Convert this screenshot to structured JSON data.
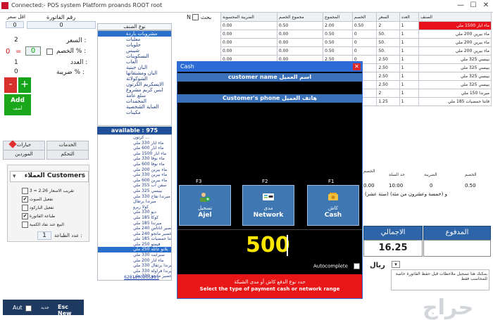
{
  "window": {
    "title": "Connected:- POS system Platform proands ROOT root",
    "controls": [
      "—",
      "☐",
      "✕"
    ]
  },
  "left_panel": {
    "invoice_label": "رقم الفاتورة",
    "invoice_value": "0",
    "min_price_label": "اقل سعر",
    "min_price_value": "0",
    "price_label": "السعر :",
    "price_value": "2",
    "discount_label": "الخصم % :",
    "discount_left": "0",
    "discount_value": "0",
    "count_label": "العدد :",
    "count_value": "1",
    "tax_label": "ضريبة % :",
    "tax_value": "0",
    "minus_label": "-",
    "plus_label": "+",
    "add_label": "Add",
    "add_sub_label": "أضف",
    "tabs": [
      {
        "label": "خيارات"
      },
      {
        "label": "الخدمات"
      },
      {
        "label": "الموردين"
      },
      {
        "label": "التحكم"
      }
    ],
    "customers_title": "العملاء Customers",
    "options": [
      {
        "label": "تقريب الاسعار 2.26 = 3",
        "checked": false
      },
      {
        "label": "تفعيل الصوت",
        "checked": true
      },
      {
        "label": "تفعيل الباركود",
        "checked": false
      },
      {
        "label": "طباعة الفاتورة",
        "checked": true
      },
      {
        "label": "البيع عند نفاد الكمية",
        "checked": false
      }
    ],
    "print_count_label": "عدد الطباعة :",
    "print_count_value": "1"
  },
  "bottom_bar": {
    "auto_label": "Aut",
    "new_label": "Esc New",
    "new_sub": "جديد"
  },
  "category": {
    "header": "نوع الصنف",
    "items": [
      {
        "label": "مشروبات باردة",
        "selected": true
      },
      {
        "label": "معلبات",
        "selected": false
      },
      {
        "label": "حلويات",
        "selected": false
      },
      {
        "label": "شيبس",
        "selected": false
      },
      {
        "label": "البسكويتات",
        "selected": false
      },
      {
        "label": "العاب",
        "selected": false
      },
      {
        "label": "البان جبنية",
        "selected": false
      },
      {
        "label": "البان ومشتقاتها",
        "selected": false
      },
      {
        "label": "الشوكولاتة",
        "selected": false
      },
      {
        "label": "الايسكريم الكرتون",
        "selected": false
      },
      {
        "label": "ايس كريم مشروع",
        "selected": false
      },
      {
        "label": "سلع عامة",
        "selected": false
      },
      {
        "label": "المجمدات",
        "selected": false
      },
      {
        "label": "العناية الشخصية",
        "selected": false
      },
      {
        "label": "مكينات",
        "selected": false
      }
    ],
    "available_label": "available : 975"
  },
  "products": {
    "items": [
      {
        "label": "كرتون ...",
        "selected": false
      },
      {
        "label": "ماء ابار 330 ملي",
        "selected": false
      },
      {
        "label": "ماء ابار 600 ملي",
        "selected": false
      },
      {
        "label": "ماء ابار 1500 ملي",
        "selected": false
      },
      {
        "label": "ماء نوفا 330 ملي",
        "selected": false
      },
      {
        "label": "ماء نوفا 600 ملي",
        "selected": false
      },
      {
        "label": "ماء بيرين 200 ملي",
        "selected": false
      },
      {
        "label": "ماء بيرين 330 ملي",
        "selected": false
      },
      {
        "label": "ماء بيرين 600 ملي",
        "selected": false
      },
      {
        "label": "سفن اب 355 ملي",
        "selected": false
      },
      {
        "label": "بيبسي 325 ملي",
        "selected": false
      },
      {
        "label": "ميرندا تفاح 330 ملي",
        "selected": false
      },
      {
        "label": "ميرندا برتقال",
        "selected": false
      },
      {
        "label": "كولا زيرو",
        "selected": false
      },
      {
        "label": "ديو 330 ملي",
        "selected": false
      },
      {
        "label": "كوكا 185 ملي",
        "selected": false
      },
      {
        "label": "ميرندا 185 ملي",
        "selected": false
      },
      {
        "label": "راني عصير اناناس 240 ملي",
        "selected": false
      },
      {
        "label": "راني عصير مانجو 240 ملي",
        "selected": false
      },
      {
        "label": "فانتا حمضيات 185 ملي",
        "selected": false
      },
      {
        "label": "فيمتو 250 ملي",
        "selected": false
      },
      {
        "label": "بلانو عائلة 250 ملي",
        "selected": true
      },
      {
        "label": "سبرايت 330 ملي",
        "selected": false
      },
      {
        "label": "ماء ابار 200 ملي",
        "selected": false
      },
      {
        "label": "ميرندا برتقال 330 ملي",
        "selected": false
      },
      {
        "label": "ميرندا فراولة 330 ملي",
        "selected": false
      },
      {
        "label": "عصير مانجو 330 ملي",
        "selected": false
      }
    ],
    "barcode": "6281100205311"
  },
  "search": {
    "label": "بحث",
    "n_label": "N"
  },
  "grid": {
    "headers": [
      "الصنف",
      "العدد",
      "السعر",
      "الخصم",
      "المجموع",
      "مجموع الخصم",
      "الضريبة المحسوبة"
    ],
    "rows": [
      [
        "ماء ابار 1500 ملي",
        "1",
        "2",
        "0.50",
        "2.00",
        "0.50",
        "0.00"
      ],
      [
        "ماء بيرين 200 ملي",
        "1",
        "50.",
        "0",
        "0.50",
        "0.00",
        "0.00"
      ],
      [
        "ماء بيرين 200 ملي",
        "1",
        "50.",
        "0",
        "0.50",
        "0.00",
        "0.00"
      ],
      [
        "ماء بيرين 200 ملي",
        "1",
        "50.",
        "0",
        "0.50",
        "0.00",
        "0.00"
      ],
      [
        "بيبسي 325 ملي",
        "1",
        "2.50",
        "0",
        "2.50",
        "0.00",
        "0.00"
      ],
      [
        "بيبسي 325 ملي",
        "1",
        "2.50",
        "0",
        "2.50",
        "0.00",
        "0.00"
      ],
      [
        "بيبسي 325 ملي",
        "1",
        "2.50",
        "0",
        "2.50",
        "0.00",
        "0.00"
      ],
      [
        "بيبسي 325 ملي",
        "1",
        "2.50",
        "0",
        "2.50",
        "0.00",
        "0.00"
      ],
      [
        "ميرندا 150 ملي",
        "1",
        "2",
        "0",
        "2.00",
        "0.00",
        "0.00"
      ],
      [
        "فانتا حمضيات 185 ملي",
        "1",
        "1.25",
        "0",
        "1.25",
        "0.00",
        "0.00"
      ]
    ],
    "selected_row": 0
  },
  "summary": {
    "headers": [
      "الخصم",
      "الضريبة",
      "حد السلة",
      "الخصم"
    ],
    "values": [
      "0.50",
      "0",
      "10:00",
      "0.00"
    ],
    "text1": "(ستة عشر) و (خمسة وعشرون من مئة)",
    "total_label": "الاجمالي",
    "total_value": "16.25",
    "paid_label": "المدفوع",
    "paid_value": "",
    "riyal_label": "ريال",
    "note": "بمكنك هنا تسجيل ملاحظات قبل حفظ الفاتورة خاصة للمحاسب فقط"
  },
  "modal": {
    "title": "Cash",
    "close_glyph": "✕",
    "customer_name_label": "customer name  اسم العميل",
    "customer_phone_label": "Customer's phone  هاتف العميل",
    "buttons": [
      {
        "fkey": "F3",
        "ar": "تسجيل",
        "en": "Ajel",
        "icon": "user-add-icon",
        "color": "#2aa84a"
      },
      {
        "fkey": "F2",
        "ar": "مدى",
        "en": "Network",
        "icon": "mada-card-icon",
        "color": "#ffffff"
      },
      {
        "fkey": "F1",
        "ar": "كاش",
        "en": "Cash",
        "icon": "cash-icon",
        "color": "#f0c040"
      }
    ],
    "amount": "500",
    "autocomplete_label": "Autocomplete",
    "autocomplete_checked": true,
    "footer_ar": "حدد نوع الدفع كاش أو مدى الشبكة",
    "footer_en": "Select the type of payment cash or network range"
  },
  "watermark": "حراج"
}
